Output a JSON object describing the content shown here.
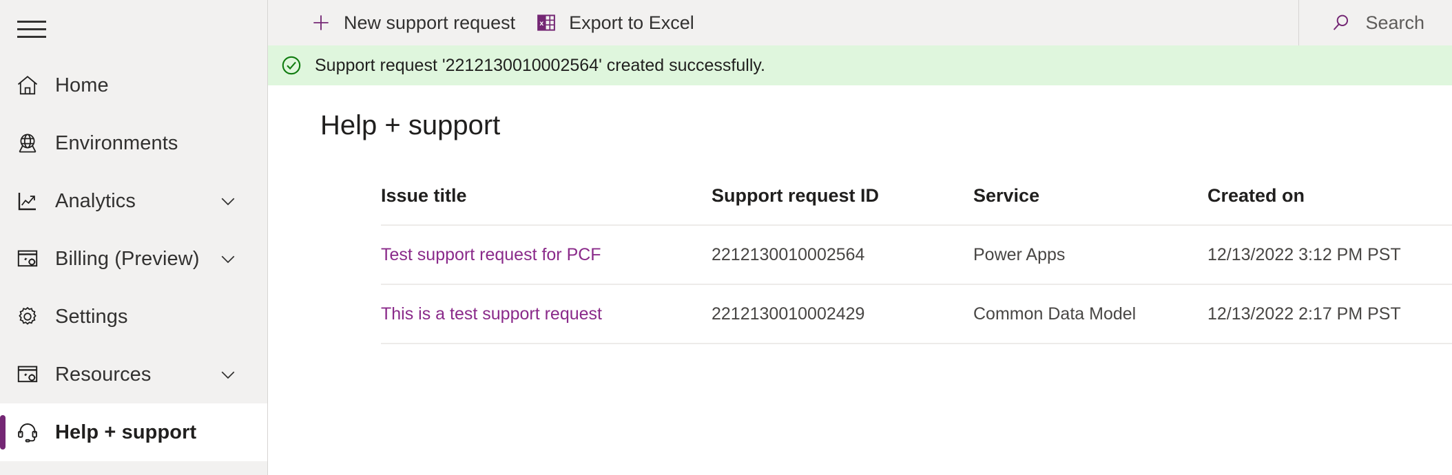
{
  "sidebar": {
    "menu_toggle": "hamburger-menu",
    "items": [
      {
        "label": "Home",
        "icon": "home-icon",
        "expandable": false,
        "selected": false
      },
      {
        "label": "Environments",
        "icon": "globe-icon",
        "expandable": false,
        "selected": false
      },
      {
        "label": "Analytics",
        "icon": "chart-icon",
        "expandable": true,
        "selected": false
      },
      {
        "label": "Billing (Preview)",
        "icon": "billing-icon",
        "expandable": true,
        "selected": false
      },
      {
        "label": "Settings",
        "icon": "gear-icon",
        "expandable": false,
        "selected": false
      },
      {
        "label": "Resources",
        "icon": "resources-icon",
        "expandable": true,
        "selected": false
      },
      {
        "label": "Help + support",
        "icon": "headset-icon",
        "expandable": false,
        "selected": true
      }
    ]
  },
  "commandbar": {
    "new_request_label": "New support request",
    "new_request_icon": "plus-icon",
    "export_label": "Export to Excel",
    "export_icon": "excel-icon"
  },
  "search": {
    "placeholder": "Search",
    "icon": "search-icon",
    "value": ""
  },
  "banner": {
    "icon": "check-circle-icon",
    "message": "Support request '2212130010002564' created successfully.",
    "background": "#dff6dd",
    "icon_color": "#107c10"
  },
  "page": {
    "title": "Help + support"
  },
  "table": {
    "columns": [
      "Issue title",
      "Support request ID",
      "Service",
      "Created on"
    ],
    "rows": [
      {
        "issue_title": "Test support request for PCF",
        "support_request_id": "2212130010002564",
        "service": "Power Apps",
        "created_on": "12/13/2022 3:12 PM PST"
      },
      {
        "issue_title": "This is a test support request",
        "support_request_id": "2212130010002429",
        "service": "Common Data Model",
        "created_on": "12/13/2022 2:17 PM PST"
      }
    ]
  },
  "colors": {
    "accent_purple": "#742774",
    "link_purple": "#8a2a8a",
    "sidebar_bg": "#f2f1f0",
    "success_green": "#dff6dd"
  }
}
